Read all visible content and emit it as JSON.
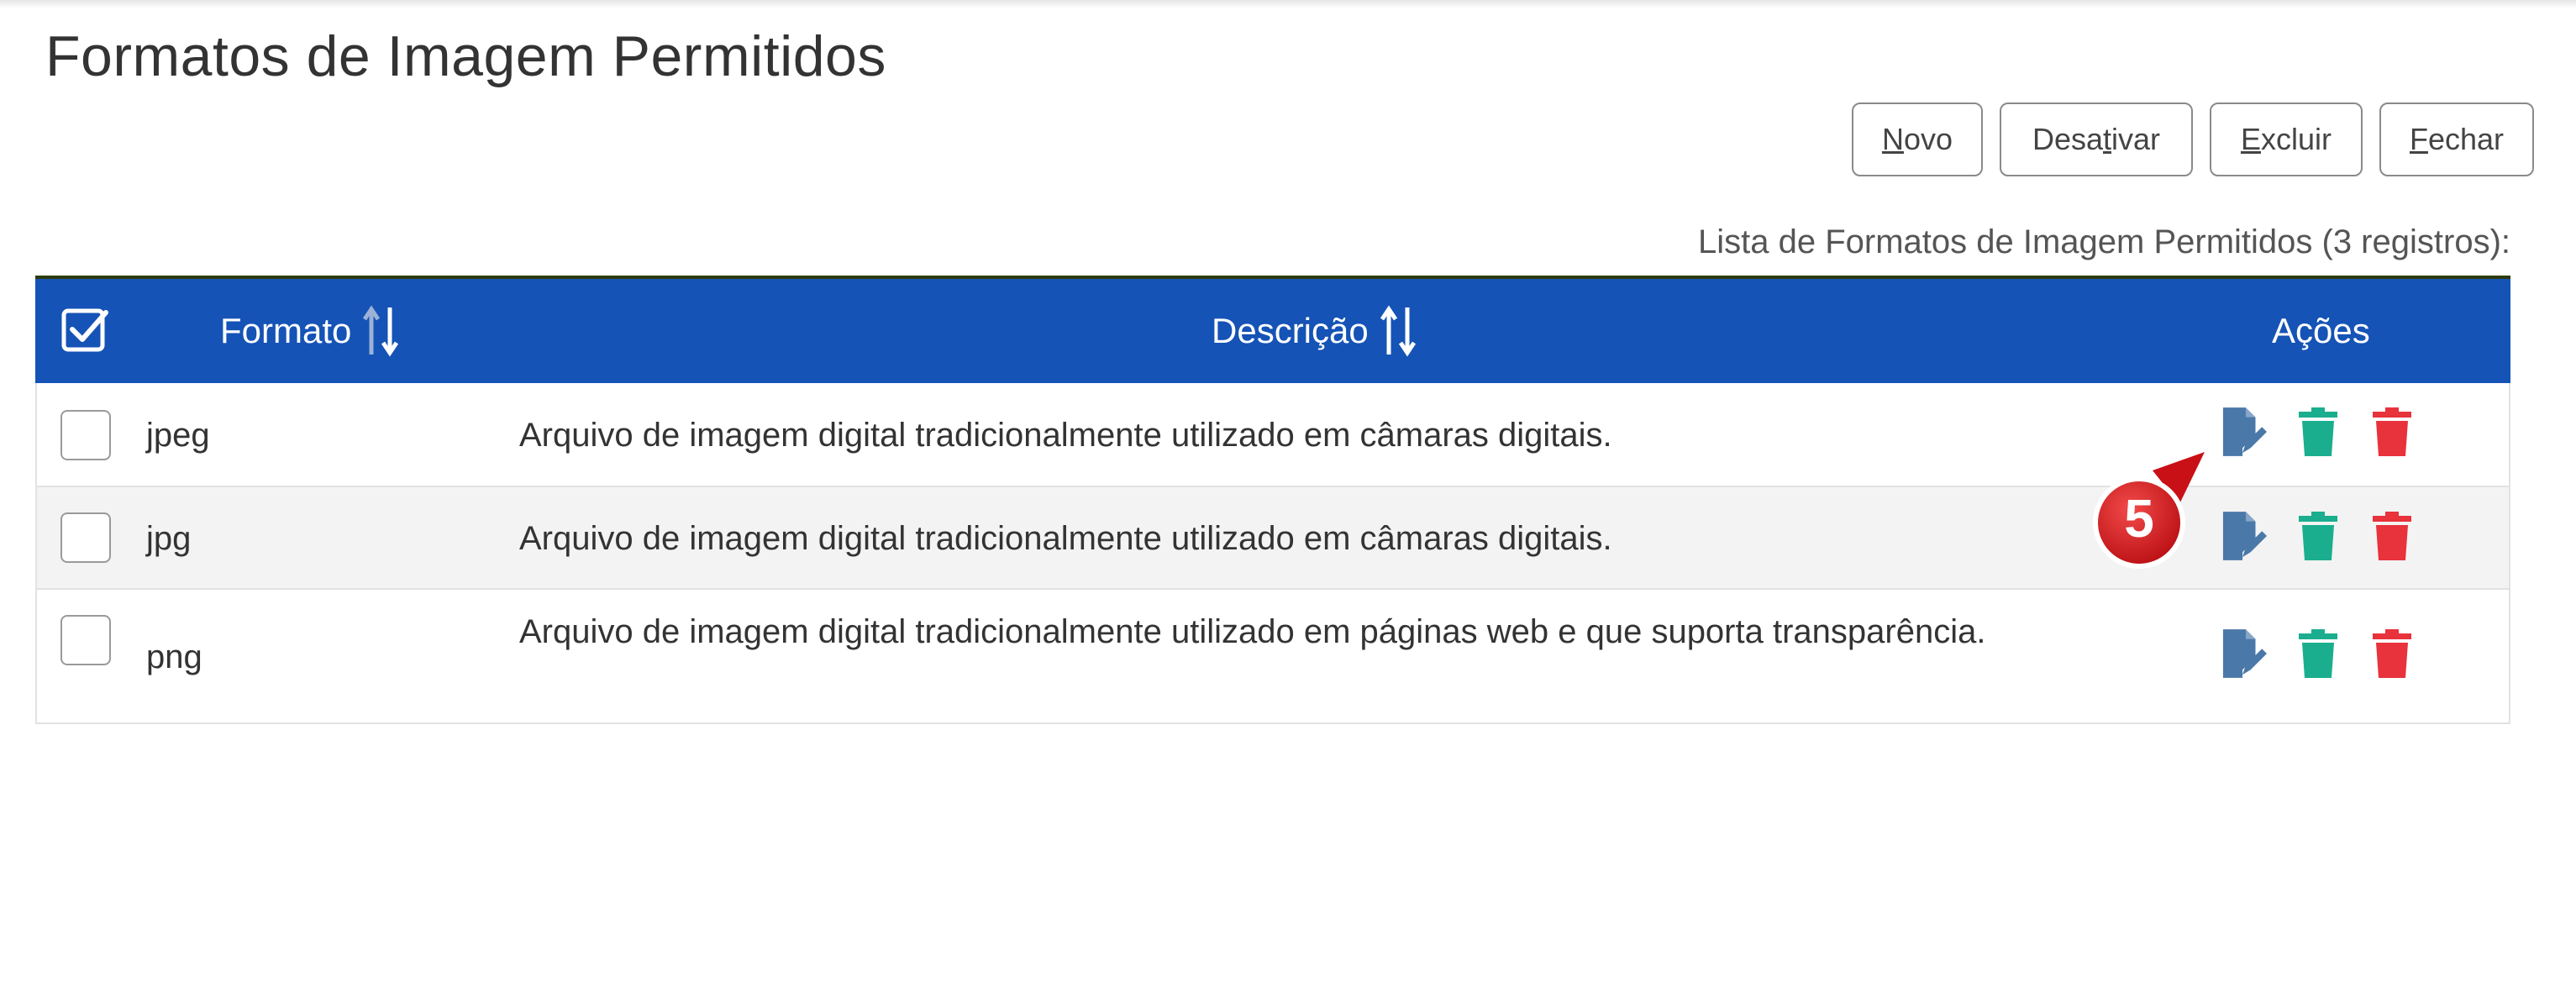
{
  "page": {
    "title": "Formatos de Imagem Permitidos"
  },
  "toolbar": {
    "novo": {
      "underlined": "N",
      "rest": "ovo"
    },
    "desativar": {
      "before": "Desa",
      "underlined": "t",
      "after": "ivar"
    },
    "excluir": {
      "underlined": "E",
      "rest": "xcluir"
    },
    "fechar": {
      "underlined": "F",
      "rest": "echar"
    }
  },
  "list": {
    "caption": "Lista de Formatos de Imagem Permitidos (3 registros):",
    "columns": {
      "format": "Formato",
      "description": "Descrição",
      "actions": "Ações"
    },
    "rows": [
      {
        "format": "jpeg",
        "description": "Arquivo de imagem digital tradicionalmente utilizado em câmaras digitais."
      },
      {
        "format": "jpg",
        "description": "Arquivo de imagem digital tradicionalmente utilizado em câmaras digitais."
      },
      {
        "format": "png",
        "description": "Arquivo de imagem digital tradicionalmente utilizado em páginas web e que suporta transparência."
      }
    ]
  },
  "callout": {
    "number": "5"
  },
  "colors": {
    "header_bg": "#1553b6",
    "edit_icon": "#4a78a8",
    "deactivate_icon": "#1aae8f",
    "delete_icon": "#e8323c",
    "callout": "#d9121a"
  },
  "icons": {
    "select_all": "checkbox-checked-icon",
    "sort": "sort-arrows-icon",
    "edit": "edit-document-icon",
    "deactivate": "trash-icon",
    "delete": "trash-icon"
  }
}
